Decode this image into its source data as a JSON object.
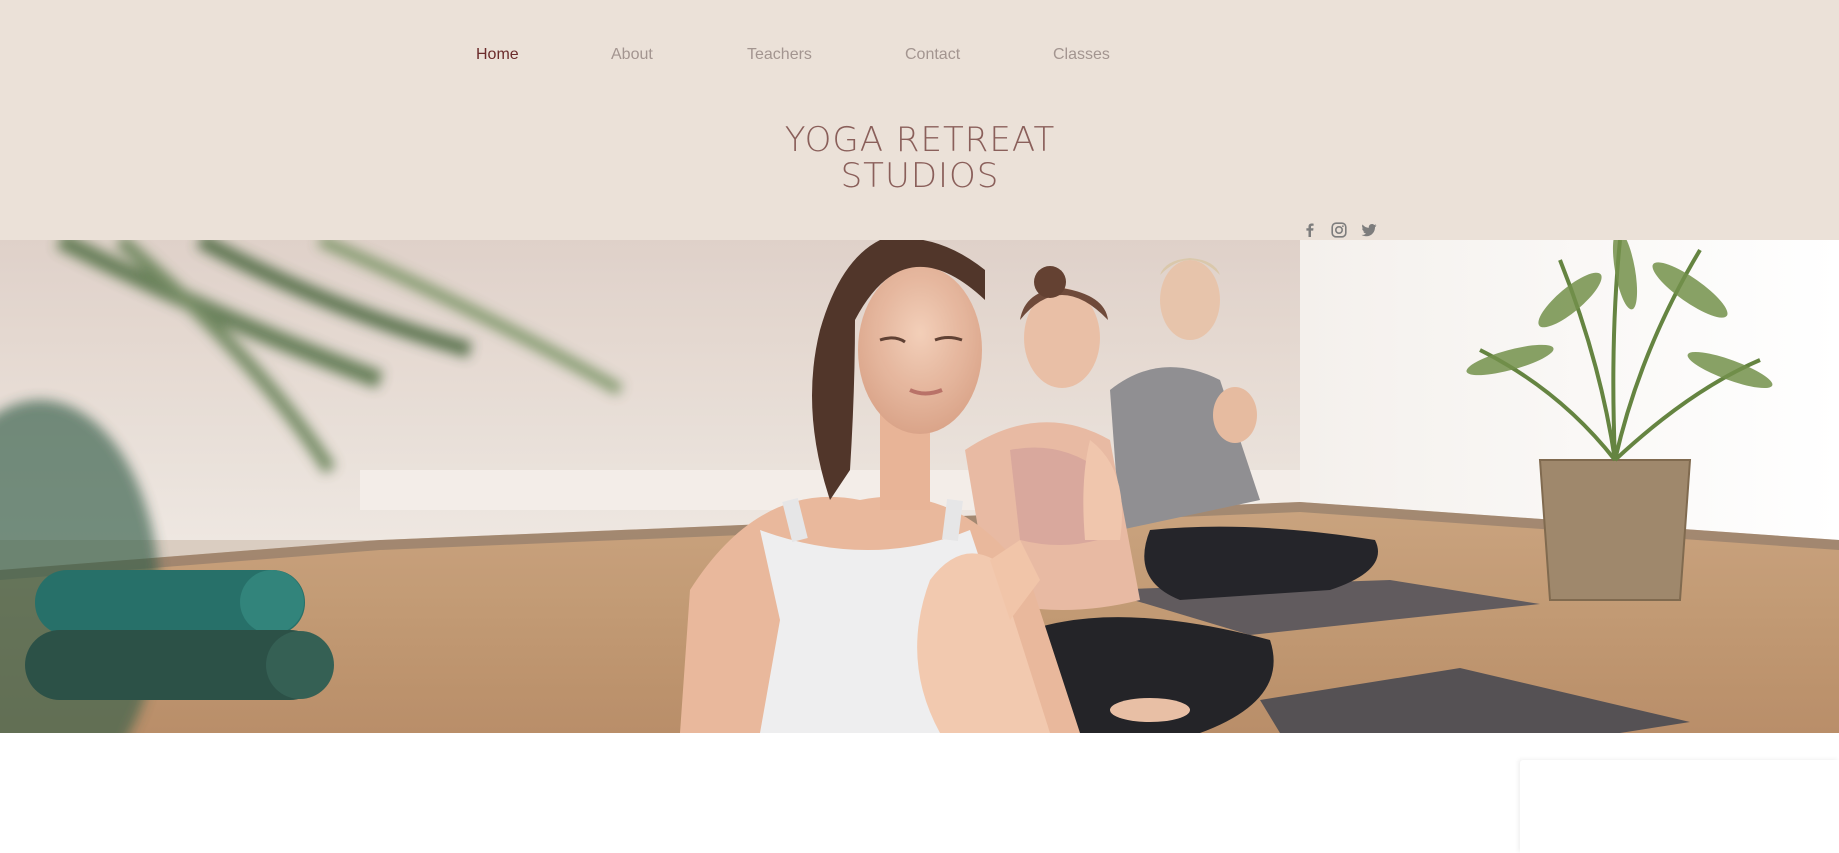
{
  "nav": {
    "items": [
      {
        "label": "Home",
        "active": true
      },
      {
        "label": "About",
        "active": false
      },
      {
        "label": "Teachers",
        "active": false
      },
      {
        "label": "Contact",
        "active": false
      },
      {
        "label": "Classes",
        "active": false
      }
    ]
  },
  "site": {
    "title_line1": "YOGA RETREAT",
    "title_line2": "STUDIOS"
  },
  "social": {
    "icons": [
      "facebook-icon",
      "instagram-icon",
      "twitter-icon"
    ],
    "color": "#7d7d7d"
  },
  "colors": {
    "header_bg": "#ebe1d8",
    "nav_active": "#6b2b2b",
    "nav_inactive": "#a39590",
    "title": "#8a5f5a"
  }
}
